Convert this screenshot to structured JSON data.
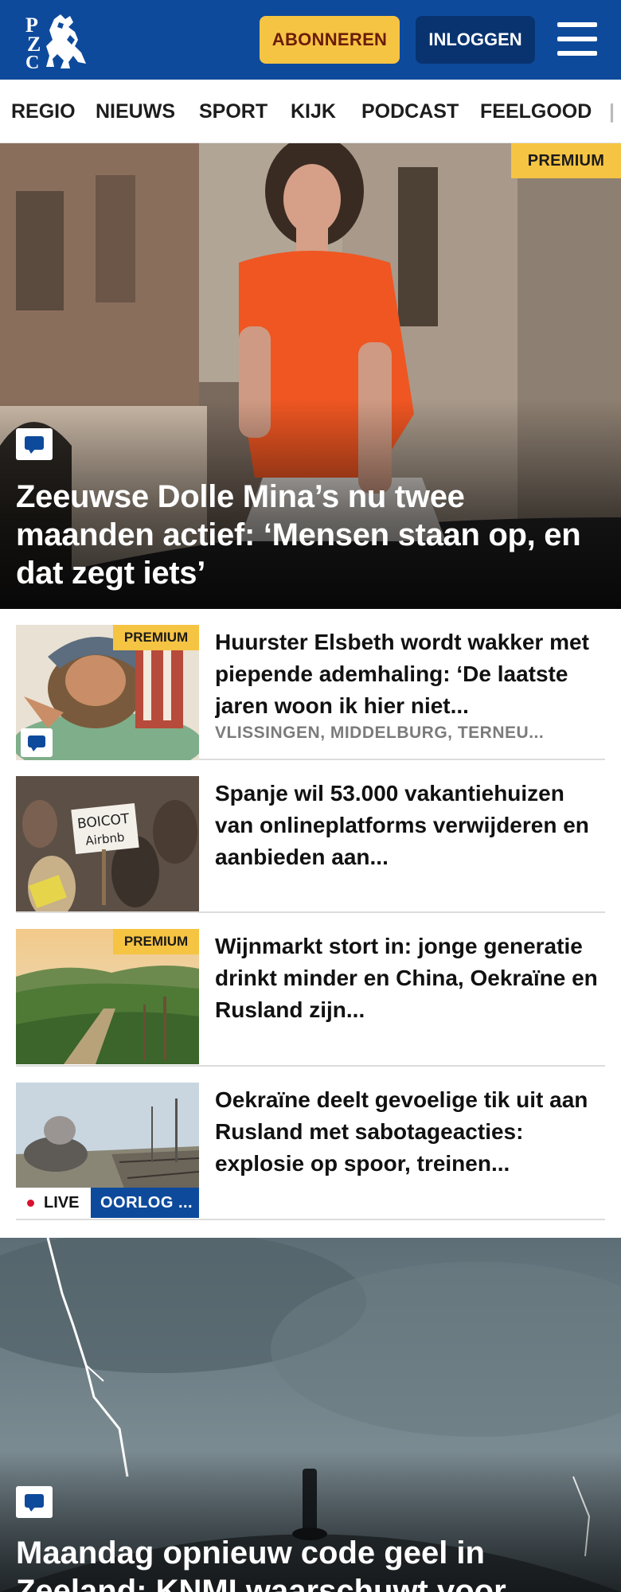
{
  "header": {
    "logo_text": [
      "P",
      "Z",
      "C"
    ],
    "subscribe_label": "ABONNEREN",
    "login_label": "INLOGGEN",
    "menu_icon": "hamburger-icon",
    "colors": {
      "brand": "#0e4a9c",
      "accent": "#f6c443",
      "login_bg": "#08336f"
    }
  },
  "nav": {
    "items": [
      "REGIO",
      "NIEUWS",
      "SPORT",
      "KIJK",
      "PODCAST",
      "FEELGOOD"
    ]
  },
  "hero": {
    "badge": "PREMIUM",
    "comment_icon": "comment-icon",
    "title": "Zeeuwse Dolle Mina’s nu twee maanden actief: ‘Mensen staan op, en dat zegt iets’"
  },
  "articles": [
    {
      "badge": "PREMIUM",
      "title": "Huurster Elsbeth wordt wakker met piepende ademhaling: ‘De laatste jaren woon ik hier niet...",
      "meta": "VLISSINGEN, MIDDELBURG, TERNEU..."
    },
    {
      "title": "Spanje wil 53.000 vakantiehui­zen van onlineplatforms verwijderen en aanbieden aan...",
      "sign_text": [
        "BOICOT",
        "Airbnb"
      ]
    },
    {
      "badge": "PREMIUM",
      "title": "Wijnmarkt stort in: jonge generatie drinkt minder en China, Oekraïne en Rusland zijn..."
    },
    {
      "title": "Oekraïne deelt gevoelige tik uit aan Rusland met sabotageacties: explosie op spoor, treinen...",
      "live_label": "LIVE",
      "tag": "OORLOG ..."
    }
  ],
  "hero2": {
    "comment_icon": "comment-icon",
    "title": "Maandag opnieuw code geel in Zeeland; KNMI waarschuwt voor"
  }
}
